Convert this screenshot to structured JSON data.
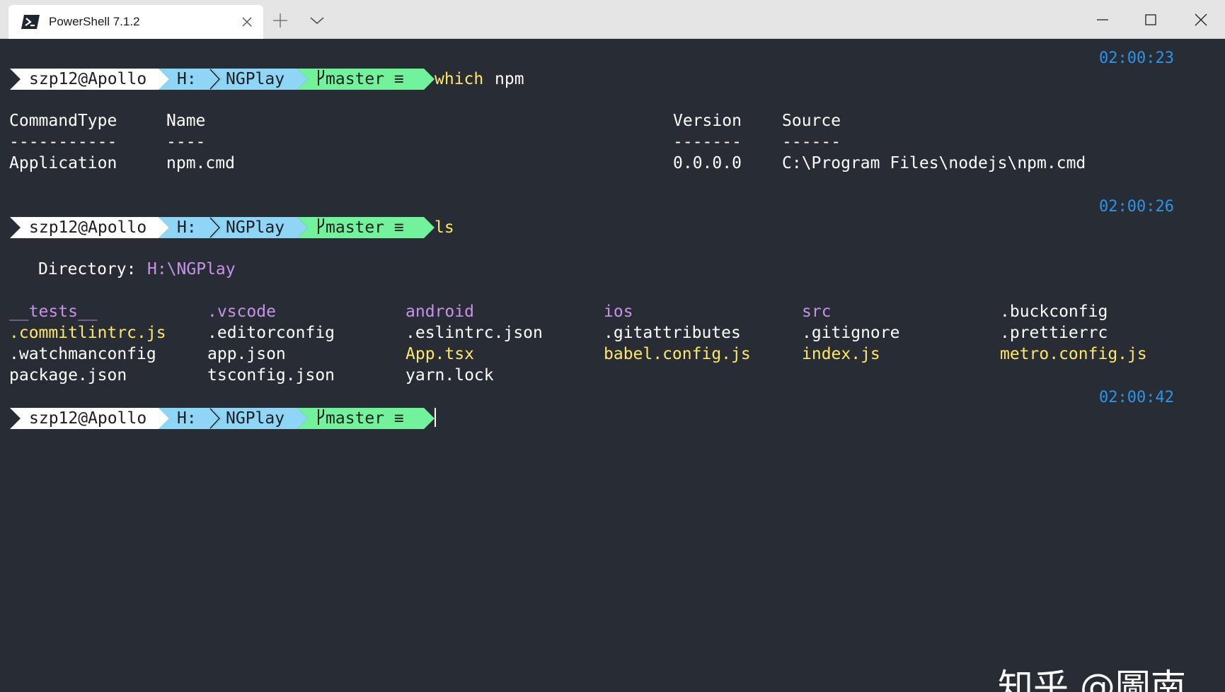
{
  "window": {
    "tab_title": "PowerShell 7.1.2",
    "tab_icon": "powershell-icon",
    "controls": [
      "minimize-icon",
      "maximize-icon",
      "close-icon"
    ]
  },
  "colors": {
    "background": "#282c34",
    "clock": "#2e94e8",
    "command": "#ffe76b",
    "directory": "#c792ea",
    "script_file": "#ffe76b",
    "prompt_user_bg": "#ffffff",
    "prompt_drive_bg": "#8fd5f6",
    "prompt_path_bg": "#8fd5f6",
    "prompt_git_bg": "#72f29b"
  },
  "prompt": {
    "user": "szp12@Apollo",
    "drive": "H:",
    "path": "NGPlay",
    "git": "master ≡",
    "git_icon": "git-branch-icon"
  },
  "block1": {
    "time": "02:00:23",
    "command": "which",
    "args": "npm",
    "table": {
      "headers": [
        "CommandType",
        "Name",
        "Version",
        "Source"
      ],
      "underlines": [
        "-----------",
        "----",
        "-------",
        "------"
      ],
      "row": [
        "Application",
        "npm.cmd",
        "0.0.0.0",
        "C:\\Program Files\\nodejs\\npm.cmd"
      ]
    }
  },
  "block2": {
    "time": "02:00:26",
    "command": "ls",
    "directory_label": "Directory:",
    "directory_path": "H:\\NGPlay",
    "files": [
      [
        {
          "name": "__tests__",
          "kind": "dir"
        },
        {
          "name": ".vscode",
          "kind": "dir"
        },
        {
          "name": "android",
          "kind": "dir"
        },
        {
          "name": "ios",
          "kind": "dir"
        },
        {
          "name": "src",
          "kind": "dir"
        },
        {
          "name": ".buckconfig",
          "kind": "file"
        }
      ],
      [
        {
          "name": ".commitlintrc.js",
          "kind": "script"
        },
        {
          "name": ".editorconfig",
          "kind": "file"
        },
        {
          "name": ".eslintrc.json",
          "kind": "file"
        },
        {
          "name": ".gitattributes",
          "kind": "file"
        },
        {
          "name": ".gitignore",
          "kind": "file"
        },
        {
          "name": ".prettierrc",
          "kind": "file"
        }
      ],
      [
        {
          "name": ".watchmanconfig",
          "kind": "file"
        },
        {
          "name": "app.json",
          "kind": "file"
        },
        {
          "name": "App.tsx",
          "kind": "script"
        },
        {
          "name": "babel.config.js",
          "kind": "script"
        },
        {
          "name": "index.js",
          "kind": "script"
        },
        {
          "name": "metro.config.js",
          "kind": "script"
        }
      ],
      [
        {
          "name": "package.json",
          "kind": "file"
        },
        {
          "name": "tsconfig.json",
          "kind": "file"
        },
        {
          "name": "yarn.lock",
          "kind": "file"
        }
      ]
    ]
  },
  "block3": {
    "time": "02:00:42"
  },
  "watermark": "知乎 @圖南"
}
